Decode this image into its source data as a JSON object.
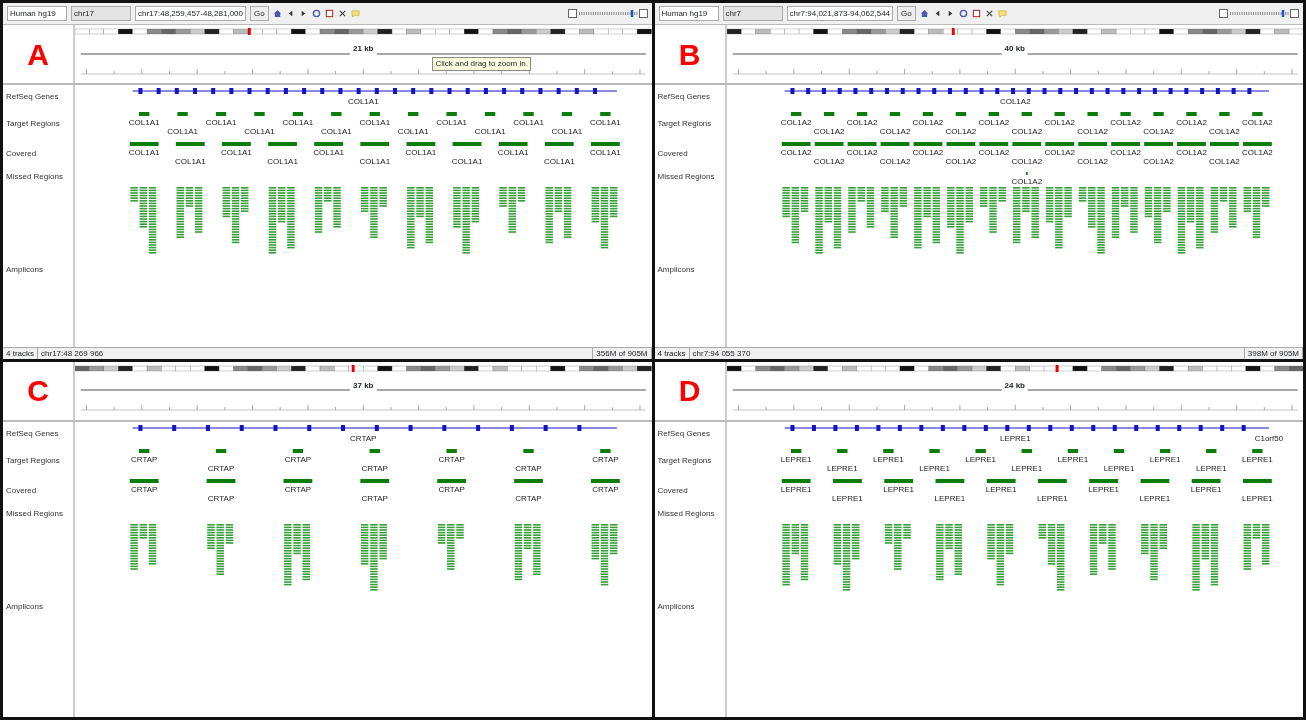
{
  "panels": [
    {
      "letter": "A",
      "genome": "Human hg19",
      "chromosome": "chr17",
      "locus": "chr17:48,259,457-48,281,000",
      "go": "Go",
      "scale": "21 kb",
      "tooltip": "Click and drag to zoom in.",
      "tracks": [
        "RefSeq Genes",
        "Target Regions",
        "Covered",
        "Missed Regions",
        "Amplicons"
      ],
      "gene_labels": [
        "COL1A1"
      ],
      "target_labels": [
        "COL1A1",
        "COL1A1",
        "COL1A1",
        "COL1A1",
        "COL1A1",
        "COL1A1",
        "COL1A1",
        "COL1A1",
        "COL1A1",
        "COL1A1",
        "COL1A1",
        "COL1A1",
        "COL1A1"
      ],
      "covered_labels": [
        "COL1A1",
        "COL1A1",
        "COL1A1",
        "COL1A1",
        "COL1A1",
        "COL1A1",
        "COL1A1",
        "COL1A1",
        "COL1A1",
        "COL1A1",
        "COL1A1"
      ],
      "zoom": {
        "level": 0.8
      },
      "status": [
        "4 tracks",
        "chr17:48 269 966",
        "356M of 905M"
      ]
    },
    {
      "letter": "B",
      "genome": "Human hg19",
      "chromosome": "chr7",
      "locus": "chr7:94,021,873-94,062,544",
      "go": "Go",
      "scale": "40 kb",
      "tracks": [
        "RefSeq Genes",
        "Target Regions",
        "Covered",
        "Missed Regions",
        "Amplicons"
      ],
      "gene_labels": [
        "COL1A2"
      ],
      "target_labels": [
        "COL1A2",
        "COL1A2",
        "COL1A2",
        "COL1A2",
        "COL1A2",
        "COL1A2",
        "COL1A2",
        "COL1A2",
        "COL1A2",
        "COL1A2",
        "COL1A2",
        "COL1A2",
        "COL1A2",
        "COL1A2",
        "COL1A2"
      ],
      "covered_labels": [
        "COL1A2",
        "COL1A2",
        "COL1A2",
        "COL1A2",
        "COL1A2",
        "COL1A2",
        "COL1A2",
        "COL1A2",
        "COL1A2",
        "COL1A2",
        "COL1A2",
        "COL1A2",
        "COL1A2",
        "COL1A2",
        "COL1A2"
      ],
      "missed_labels": [
        "COL1A2"
      ],
      "zoom": {
        "level": 0.8
      },
      "status": [
        "4 tracks",
        "chr7:94 055 370",
        "398M of 905M"
      ]
    },
    {
      "letter": "C",
      "scale": "37 kb",
      "tracks": [
        "RefSeq Genes",
        "Target Regions",
        "Covered",
        "Missed Regions",
        "Amplicons"
      ],
      "gene_labels": [
        "CRTAP"
      ],
      "target_labels": [
        "CRTAP",
        "CRTAP",
        "CRTAP",
        "CRTAP",
        "CRTAP",
        "CRTAP",
        "CRTAP"
      ],
      "covered_labels": [
        "CRTAP",
        "CRTAP",
        "CRTAP",
        "CRTAP",
        "CRTAP",
        "CRTAP",
        "CRTAP"
      ]
    },
    {
      "letter": "D",
      "scale": "24 kb",
      "tracks": [
        "RefSeq Genes",
        "Target Regions",
        "Covered",
        "Missed Regions",
        "Amplicons"
      ],
      "gene_labels": [
        "LEPRE1",
        "C1orf50"
      ],
      "target_labels": [
        "LEPRE1",
        "LEPRE1",
        "LEPRE1",
        "LEPRE1",
        "LEPRE1",
        "LEPRE1",
        "LEPRE1",
        "LEPRE1",
        "LEPRE1",
        "LEPRE1",
        "LEPRE1"
      ],
      "covered_labels": [
        "LEPRE1",
        "LEPRE1",
        "LEPRE1",
        "LEPRE1",
        "LEPRE1",
        "LEPRE1",
        "LEPRE1",
        "LEPRE1",
        "LEPRE1",
        "LEPRE1"
      ]
    }
  ]
}
